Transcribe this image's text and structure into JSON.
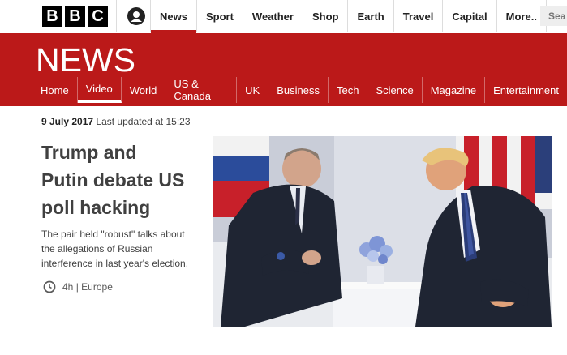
{
  "logo": [
    "B",
    "B",
    "C"
  ],
  "topnav": {
    "items": [
      "News",
      "Sport",
      "Weather",
      "Shop",
      "Earth",
      "Travel",
      "Capital",
      "More.."
    ],
    "active": "News",
    "search_placeholder": "Sea"
  },
  "brand": {
    "section_title": "NEWS",
    "accent_color": "#bb1919"
  },
  "secnav": {
    "items": [
      "Home",
      "Video",
      "World",
      "US & Canada",
      "UK",
      "Business",
      "Tech",
      "Science",
      "Magazine",
      "Entertainment"
    ],
    "active": "Video"
  },
  "article": {
    "date": "9 July 2017",
    "updated": "Last updated at 15:23",
    "headline_lines": [
      "Trump and",
      "Putin debate US",
      "poll hacking"
    ],
    "summary_lines": [
      "The pair held \"robust\" talks about",
      "the allegations of Russian",
      "interference in last year's election."
    ],
    "age": "4h",
    "separator": "|",
    "section": "Europe"
  },
  "icons": {
    "account": "user-icon",
    "clock": "clock-icon"
  }
}
